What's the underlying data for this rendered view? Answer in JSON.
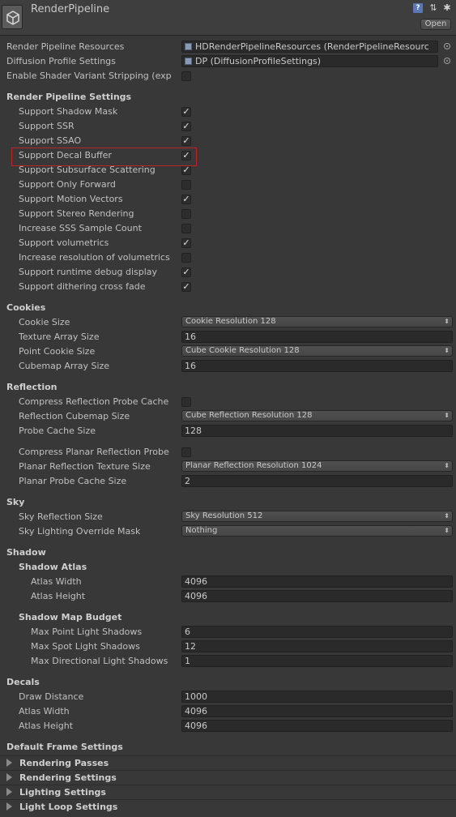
{
  "header": {
    "title": "RenderPipeline",
    "open_label": "Open",
    "help_glyph": "?",
    "preset_glyph": "⇅",
    "gear_glyph": "✱"
  },
  "top": {
    "resources_label": "Render Pipeline Resources",
    "resources_value": "HDRenderPipelineResources (RenderPipelineResourc",
    "diffusion_label": "Diffusion Profile Settings",
    "diffusion_value": "DP (DiffusionProfileSettings)",
    "stripping_label": "Enable Shader Variant Stripping (exp",
    "stripping_checked": false
  },
  "rps": {
    "title": "Render Pipeline Settings",
    "items": [
      {
        "label": "Support Shadow Mask",
        "checked": true
      },
      {
        "label": "Support SSR",
        "checked": true
      },
      {
        "label": "Support SSAO",
        "checked": true
      },
      {
        "label": "Support Decal Buffer",
        "checked": true
      },
      {
        "label": "Support Subsurface Scattering",
        "checked": true
      },
      {
        "label": "Support Only Forward",
        "checked": false
      },
      {
        "label": "Support Motion Vectors",
        "checked": true
      },
      {
        "label": "Support Stereo Rendering",
        "checked": false
      },
      {
        "label": "Increase SSS Sample Count",
        "checked": false
      },
      {
        "label": "Support volumetrics",
        "checked": true
      },
      {
        "label": "Increase resolution of volumetrics",
        "checked": false
      },
      {
        "label": "Support runtime debug display",
        "checked": true
      },
      {
        "label": "Support dithering cross fade",
        "checked": true
      }
    ]
  },
  "cookies": {
    "title": "Cookies",
    "cookie_size_label": "Cookie Size",
    "cookie_size_value": "Cookie Resolution 128",
    "texture_array_label": "Texture Array Size",
    "texture_array_value": "16",
    "point_cookie_label": "Point Cookie Size",
    "point_cookie_value": "Cube Cookie Resolution 128",
    "cubemap_array_label": "Cubemap Array Size",
    "cubemap_array_value": "16"
  },
  "reflection": {
    "title": "Reflection",
    "compress_probe_label": "Compress Reflection Probe Cache",
    "compress_probe_checked": false,
    "cubemap_size_label": "Reflection Cubemap Size",
    "cubemap_size_value": "Cube Reflection Resolution 128",
    "probe_cache_label": "Probe Cache Size",
    "probe_cache_value": "128",
    "compress_planar_label": "Compress Planar Reflection Probe",
    "compress_planar_checked": false,
    "planar_tex_label": "Planar Reflection Texture Size",
    "planar_tex_value": "Planar Reflection Resolution 1024",
    "planar_cache_label": "Planar Probe Cache Size",
    "planar_cache_value": "2"
  },
  "sky": {
    "title": "Sky",
    "reflection_size_label": "Sky Reflection Size",
    "reflection_size_value": "Sky Resolution 512",
    "override_mask_label": "Sky Lighting Override Mask",
    "override_mask_value": "Nothing"
  },
  "shadow": {
    "title": "Shadow",
    "atlas_title": "Shadow Atlas",
    "atlas_width_label": "Atlas Width",
    "atlas_width_value": "4096",
    "atlas_height_label": "Atlas Height",
    "atlas_height_value": "4096",
    "budget_title": "Shadow Map Budget",
    "max_point_label": "Max Point Light Shadows",
    "max_point_value": "6",
    "max_spot_label": "Max Spot Light Shadows",
    "max_spot_value": "12",
    "max_dir_label": "Max Directional Light Shadows",
    "max_dir_value": "1"
  },
  "decals": {
    "title": "Decals",
    "draw_distance_label": "Draw Distance",
    "draw_distance_value": "1000",
    "atlas_width_label": "Atlas Width",
    "atlas_width_value": "4096",
    "atlas_height_label": "Atlas Height",
    "atlas_height_value": "4096"
  },
  "frame": {
    "title": "Default Frame Settings",
    "foldouts": [
      "Rendering Passes",
      "Rendering Settings",
      "Lighting Settings",
      "Light Loop Settings"
    ]
  },
  "check_glyph": "✓",
  "dropdown_glyph": "⬍",
  "colors": {
    "background": "#383838",
    "highlight": "#b8262a"
  }
}
